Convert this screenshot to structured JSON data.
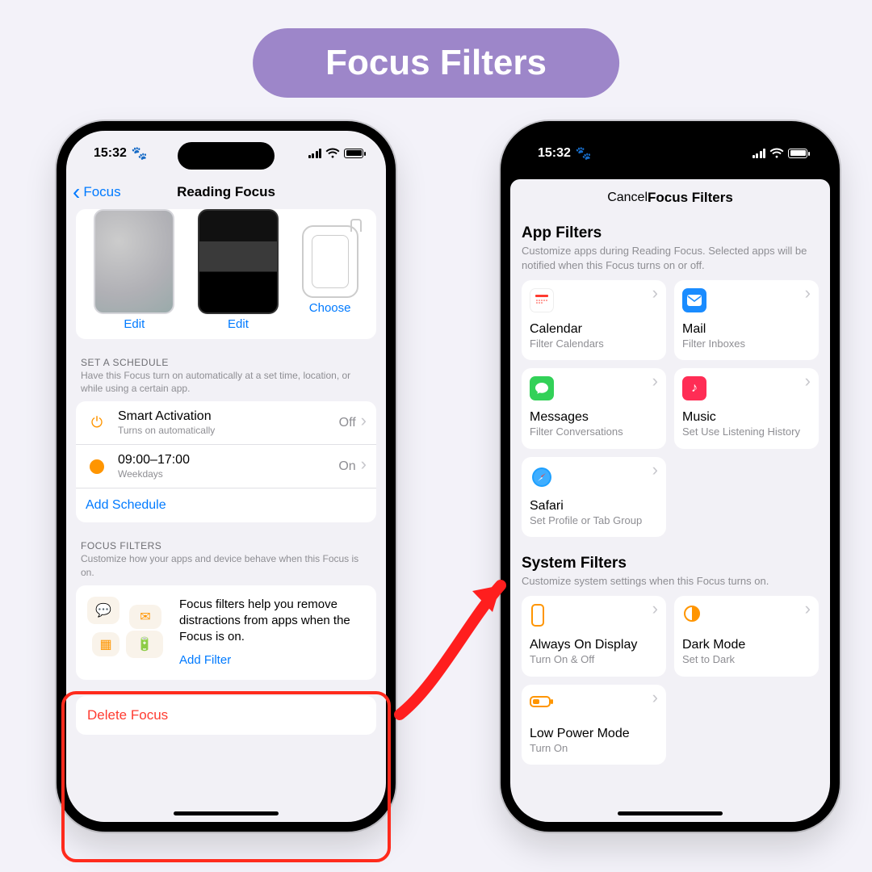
{
  "banner": {
    "title": "Focus Filters"
  },
  "status": {
    "time": "15:32",
    "glyph": "🐾"
  },
  "left": {
    "nav": {
      "back": "Focus",
      "title": "Reading Focus"
    },
    "thumbs": {
      "edit1": "Edit",
      "edit2": "Edit",
      "choose": "Choose"
    },
    "schedule": {
      "header": "SET A SCHEDULE",
      "sub": "Have this Focus turn on automatically at a set time, location, or while using a certain app.",
      "smart": {
        "title": "Smart Activation",
        "sub": "Turns on automatically",
        "state": "Off"
      },
      "time": {
        "title": "09:00–17:00",
        "sub": "Weekdays",
        "state": "On"
      },
      "add": "Add Schedule"
    },
    "focusFilters": {
      "header": "FOCUS FILTERS",
      "sub": "Customize how your apps and device behave when this Focus is on.",
      "desc": "Focus filters help you remove distractions from apps when the Focus is on.",
      "add": "Add Filter"
    },
    "delete": "Delete Focus"
  },
  "right": {
    "nav": {
      "cancel": "Cancel",
      "title": "Focus Filters"
    },
    "appFilters": {
      "header": "App Filters",
      "sub": "Customize apps during Reading Focus. Selected apps will be notified when this Focus turns on or off.",
      "items": {
        "calendar": {
          "title": "Calendar",
          "sub": "Filter Calendars"
        },
        "mail": {
          "title": "Mail",
          "sub": "Filter Inboxes"
        },
        "messages": {
          "title": "Messages",
          "sub": "Filter Conversations"
        },
        "music": {
          "title": "Music",
          "sub": "Set Use Listening History"
        },
        "safari": {
          "title": "Safari",
          "sub": "Set Profile or Tab Group"
        }
      }
    },
    "systemFilters": {
      "header": "System Filters",
      "sub": "Customize system settings when this Focus turns on.",
      "items": {
        "aod": {
          "title": "Always On Display",
          "sub": "Turn On & Off"
        },
        "dark": {
          "title": "Dark Mode",
          "sub": "Set to Dark"
        },
        "lpm": {
          "title": "Low Power Mode",
          "sub": "Turn On"
        }
      }
    }
  }
}
